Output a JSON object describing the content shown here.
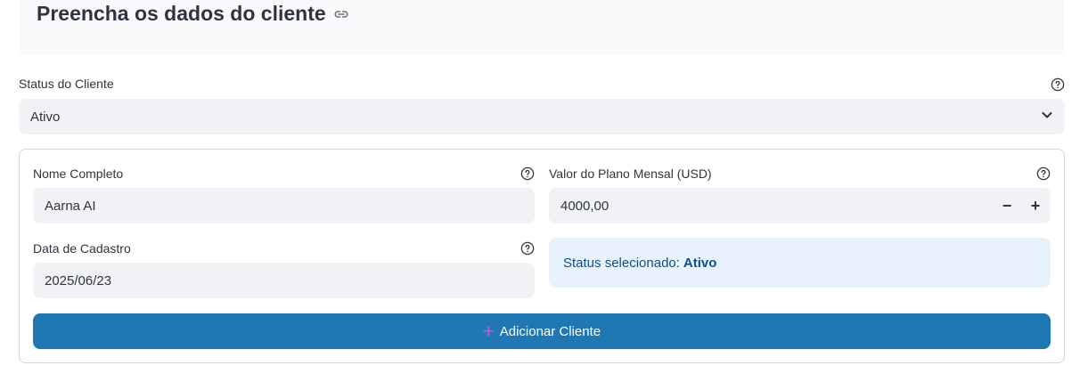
{
  "header": {
    "title": "Preencha os dados do cliente"
  },
  "status_select": {
    "label": "Status do Cliente",
    "value": "Ativo"
  },
  "form": {
    "name": {
      "label": "Nome Completo",
      "value": "Aarna AI"
    },
    "plan_value": {
      "label": "Valor do Plano Mensal (USD)",
      "value": "4000,00",
      "minus": "−",
      "plus": "+"
    },
    "signup_date": {
      "label": "Data de Cadastro",
      "value": "2025/06/23"
    },
    "status_info": {
      "prefix": "Status selecionado:",
      "value": "Ativo"
    },
    "submit": {
      "icon": "plus-icon",
      "label": "Adicionar Cliente"
    }
  },
  "colors": {
    "primary": "#1f77b4",
    "info_bg": "#e8f2fc",
    "info_text": "#0e4f8f",
    "input_bg": "#f0f2f6"
  }
}
